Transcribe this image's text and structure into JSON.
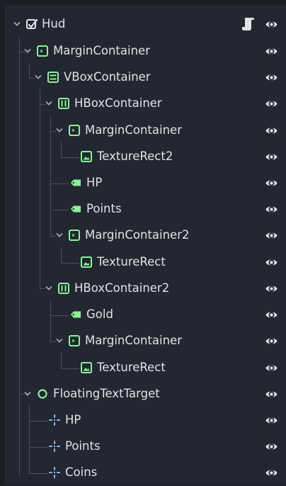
{
  "colors": {
    "background": "#222731",
    "text": "#e0e3e8",
    "icon_green": "#8eef97",
    "guide": "#4a4f58",
    "eye": "#e0e3e8"
  },
  "tree": {
    "nodes": [
      {
        "label": "Hud",
        "icon": "control-node-icon",
        "expanded": true,
        "has_script": true
      },
      {
        "label": "MarginContainer",
        "icon": "margin-container-icon",
        "expanded": true
      },
      {
        "label": "VBoxContainer",
        "icon": "vbox-container-icon",
        "expanded": true
      },
      {
        "label": "HBoxContainer",
        "icon": "hbox-container-icon",
        "expanded": true
      },
      {
        "label": "MarginContainer",
        "icon": "margin-container-icon",
        "expanded": true
      },
      {
        "label": "TextureRect2",
        "icon": "texture-rect-icon"
      },
      {
        "label": "HP",
        "icon": "label-icon"
      },
      {
        "label": "Points",
        "icon": "label-icon"
      },
      {
        "label": "MarginContainer2",
        "icon": "margin-container-icon",
        "expanded": true
      },
      {
        "label": "TextureRect",
        "icon": "texture-rect-icon"
      },
      {
        "label": "HBoxContainer2",
        "icon": "hbox-container-icon",
        "expanded": true
      },
      {
        "label": "Gold",
        "icon": "label-icon"
      },
      {
        "label": "MarginContainer",
        "icon": "margin-container-icon",
        "expanded": true
      },
      {
        "label": "TextureRect",
        "icon": "texture-rect-icon"
      },
      {
        "label": "FloatingTextTarget",
        "icon": "node2d-icon",
        "expanded": true
      },
      {
        "label": "HP",
        "icon": "marker2d-icon"
      },
      {
        "label": "Points",
        "icon": "marker2d-icon"
      },
      {
        "label": "Coins",
        "icon": "marker2d-icon"
      }
    ]
  }
}
